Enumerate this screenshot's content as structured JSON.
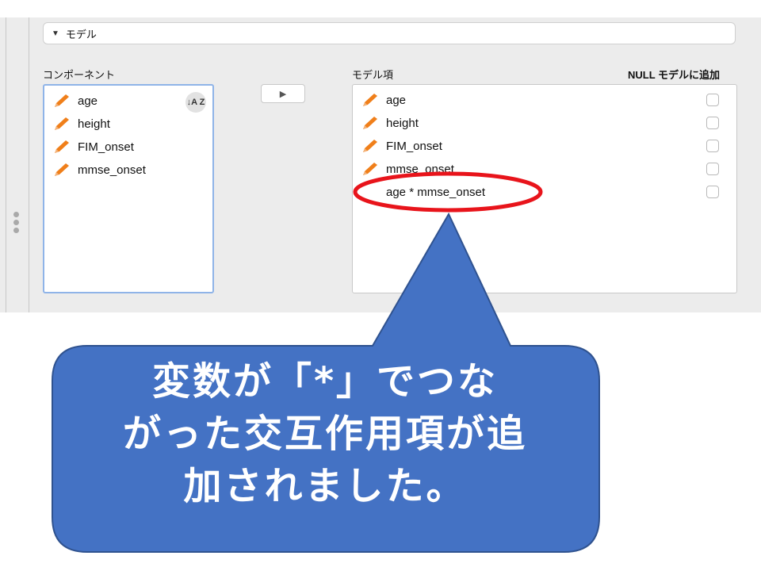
{
  "section": {
    "title": "モデル",
    "toggle": "▼"
  },
  "components": {
    "label": "コンポーネント",
    "sort_icon": "↓A Z",
    "items": [
      "age",
      "height",
      "FIM_onset",
      "mmse_onset"
    ]
  },
  "move_button": {
    "glyph": "▶"
  },
  "model_terms": {
    "label": "モデル項",
    "null_label": "NULL モデルに追加",
    "items": [
      "age",
      "height",
      "FIM_onset",
      "mmse_onset",
      "age * mmse_onset"
    ]
  },
  "callout": {
    "line1": "変数が「*」でつな",
    "line2": "がった交互作用項が追",
    "line3": "加されました。"
  },
  "colors": {
    "callout_fill": "#4472c4",
    "callout_border": "#2f528f",
    "highlight_ring": "#e8141b",
    "pencil": "#f07f1a",
    "selection_border": "#8fb4e8"
  },
  "icons": {
    "variable": "pencil-icon",
    "sort": "sort-az-icon",
    "move": "arrow-right-icon"
  }
}
